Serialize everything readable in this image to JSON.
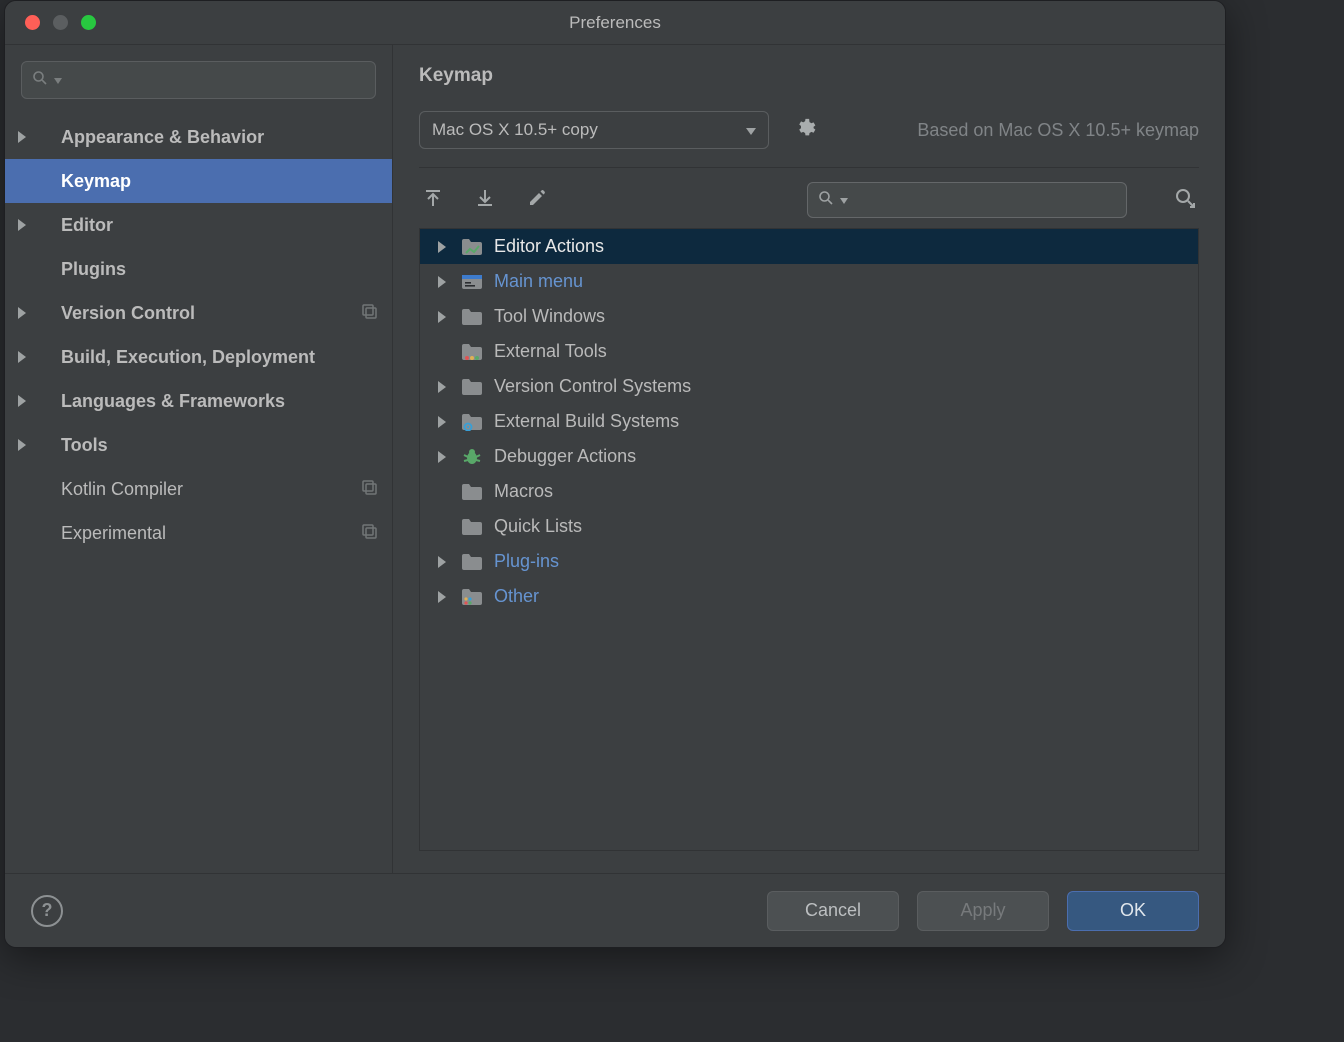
{
  "window": {
    "title": "Preferences"
  },
  "sidebar": {
    "search_placeholder": "",
    "items": [
      {
        "label": "Appearance & Behavior",
        "expandable": true,
        "bold": true
      },
      {
        "label": "Keymap",
        "expandable": false,
        "bold": true,
        "selected": true
      },
      {
        "label": "Editor",
        "expandable": true,
        "bold": true
      },
      {
        "label": "Plugins",
        "expandable": false,
        "bold": true
      },
      {
        "label": "Version Control",
        "expandable": true,
        "bold": true,
        "reset": true
      },
      {
        "label": "Build, Execution, Deployment",
        "expandable": true,
        "bold": true
      },
      {
        "label": "Languages & Frameworks",
        "expandable": true,
        "bold": true
      },
      {
        "label": "Tools",
        "expandable": true,
        "bold": true
      },
      {
        "label": "Kotlin Compiler",
        "expandable": false,
        "bold": false,
        "reset": true
      },
      {
        "label": "Experimental",
        "expandable": false,
        "bold": false,
        "reset": true
      }
    ]
  },
  "main": {
    "section": "Keymap",
    "dropdown": "Mac OS X 10.5+ copy",
    "based_on": "Based on Mac OS X 10.5+ keymap",
    "search_placeholder": "",
    "tree": [
      {
        "label": "Editor Actions",
        "expandable": true,
        "icon": "editor",
        "selected": true
      },
      {
        "label": "Main menu",
        "expandable": true,
        "icon": "menu",
        "link": true
      },
      {
        "label": "Tool Windows",
        "expandable": true,
        "icon": "folder"
      },
      {
        "label": "External Tools",
        "expandable": false,
        "icon": "ext-tools"
      },
      {
        "label": "Version Control Systems",
        "expandable": true,
        "icon": "folder"
      },
      {
        "label": "External Build Systems",
        "expandable": true,
        "icon": "folder-gear"
      },
      {
        "label": "Debugger Actions",
        "expandable": true,
        "icon": "bug"
      },
      {
        "label": "Macros",
        "expandable": false,
        "icon": "folder"
      },
      {
        "label": "Quick Lists",
        "expandable": false,
        "icon": "folder"
      },
      {
        "label": "Plug-ins",
        "expandable": true,
        "icon": "folder",
        "link": true
      },
      {
        "label": "Other",
        "expandable": true,
        "icon": "other",
        "link": true
      }
    ]
  },
  "footer": {
    "cancel": "Cancel",
    "apply": "Apply",
    "ok": "OK"
  }
}
